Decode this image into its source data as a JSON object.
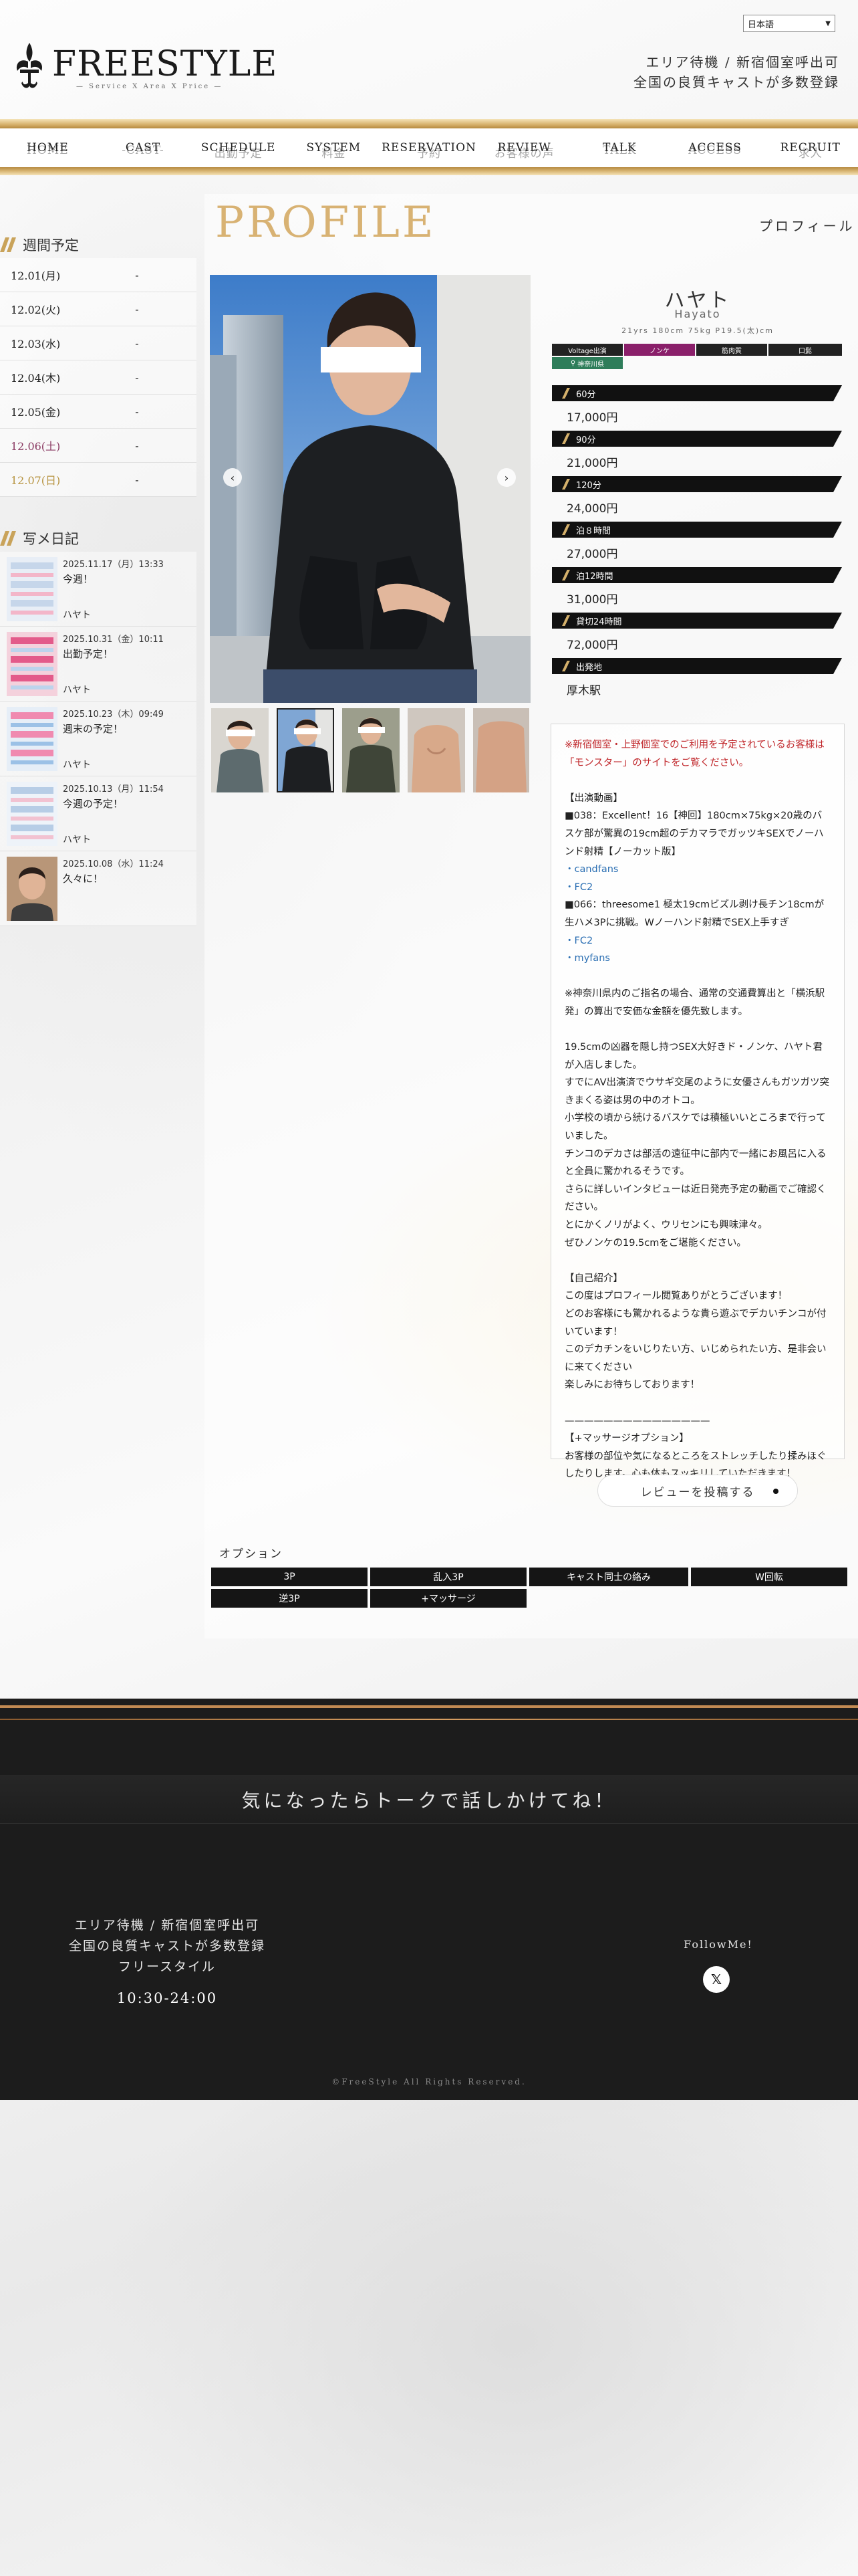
{
  "header": {
    "language": "日本語",
    "logo_text": "FREESTYLE",
    "logo_sub": "— Service X Area X Price —",
    "tagline_1": "エリア待機 / 新宿個室呼出可",
    "tagline_2": "全国の良質キャストが多数登録"
  },
  "nav": {
    "items": [
      {
        "label": "HOME",
        "ghost": "HOME"
      },
      {
        "label": "CAST",
        "ghost": "-CAST-"
      },
      {
        "label": "SCHEDULE",
        "ghost": "出勤予定"
      },
      {
        "label": "SYSTEM",
        "ghost": "料金"
      },
      {
        "label": "RESERVATION",
        "ghost": "予約"
      },
      {
        "label": "REVIEW",
        "ghost": "お客様の声"
      },
      {
        "label": "TALK",
        "ghost": "TALK"
      },
      {
        "label": "ACCESS",
        "ghost": "ACCESS"
      },
      {
        "label": "RECRUIT",
        "ghost": "求人"
      }
    ]
  },
  "sidebar": {
    "schedule_title": "週間予定",
    "schedule": [
      {
        "date": "12.01(月)",
        "value": "-"
      },
      {
        "date": "12.02(火)",
        "value": "-"
      },
      {
        "date": "12.03(水)",
        "value": "-"
      },
      {
        "date": "12.04(木)",
        "value": "-"
      },
      {
        "date": "12.05(金)",
        "value": "-"
      },
      {
        "date": "12.06(土)",
        "value": "-"
      },
      {
        "date": "12.07(日)",
        "value": "-"
      }
    ],
    "diary_title": "写メ日記",
    "diary": [
      {
        "date": "2025.11.17（月）13:33",
        "title": "今週！",
        "author": "ハヤト"
      },
      {
        "date": "2025.10.31（金）10:11",
        "title": "出勤予定！",
        "author": "ハヤト"
      },
      {
        "date": "2025.10.23（木）09:49",
        "title": "週末の予定！",
        "author": "ハヤト"
      },
      {
        "date": "2025.10.13（月）11:54",
        "title": "今週の予定！",
        "author": "ハヤト"
      },
      {
        "date": "2025.10.08（水）11:24",
        "title": "久々に！",
        "author": ""
      }
    ]
  },
  "profile": {
    "heading": "PROFILE",
    "heading_jp": "プロフィール",
    "name_jp": "ハヤト",
    "name_en": "Hayato",
    "specs": "21yrs 180cm 75kg P19.5(太)cm",
    "tags": [
      "Voltage出演",
      "ノンケ",
      "筋肉質",
      "口髭",
      "神奈川県"
    ],
    "prices": [
      {
        "label": "60分",
        "value": "17,000円"
      },
      {
        "label": "90分",
        "value": "21,000円"
      },
      {
        "label": "120分",
        "value": "24,000円"
      },
      {
        "label": "泊８時間",
        "value": "27,000円"
      },
      {
        "label": "泊12時間",
        "value": "31,000円"
      },
      {
        "label": "貸切24時間",
        "value": "72,000円"
      },
      {
        "label": "出発地",
        "value": "厚木駅"
      }
    ],
    "review_button": "レビューを投稿する",
    "options_title": "オプション",
    "options": [
      "3P",
      "乱入3P",
      "キャスト同士の絡み",
      "W回転",
      "逆3P",
      "+マッサージ"
    ]
  },
  "description": {
    "notice": "※新宿個室・上野個室でのご利用を予定されているお客様は「モンスター」のサイトをご覧ください。",
    "lines": [
      "",
      "【出演動画】",
      "■038：Excellent！16【神回】180cm×75kg×20歳のバスケ部が驚異の19cm超のデカマラでガッツキSEXでノーハンド射精【ノーカット版】",
      "・candfans",
      "・FC2",
      "■066：threesome1 極太19cmビズル剥け長チン18cmが生ハメ3Pに挑戦。Wノーハンド射精でSEX上手すぎ",
      "・FC2",
      "・myfans",
      "",
      "※神奈川県内のご指名の場合、通常の交通費算出と「横浜駅発」の算出で安価な金額を優先致します。",
      "",
      "19.5cmの凶器を隠し持つSEX大好きド・ノンケ、ハヤト君が入店しました。",
      "すでにAV出演済でウサギ交尾のように女優さんもガツガツ突きまくる姿は男の中のオトコ。",
      "小学校の頃から続けるバスケでは積極いいところまで行っていました。",
      "チンコのデカさは部活の遠征中に部内で一緒にお風呂に入ると全員に驚かれるそうです。",
      "さらに詳しいインタビューは近日発売予定の動画でご確認ください。",
      "とにかくノリがよく、ウリセンにも興味津々。",
      "ぜひノンケの19.5cmをご堪能ください。",
      "",
      "【自己紹介】",
      "この度はプロフィール閲覧ありがとうございます！",
      "どのお客様にも驚かれるような貴ら遊ぶでデカいチンコが付いています！",
      "このデカチンをいじりたい方、いじめられたい方、是非会いに来てください",
      "楽しみにお待ちしております！",
      "",
      "———————————————",
      "【+マッサージオプション】",
      "お客様の部位や気になるところをストレッチしたり揉みほぐしたりします。心も体もスッキリしていただきます！"
    ]
  },
  "footer": {
    "talk_banner": "気になったらトークで話しかけてね！",
    "line1": "エリア待機 / 新宿個室呼出可",
    "line2": "全国の良質キャストが多数登録",
    "line3": "フリースタイル",
    "hours": "10:30-24:00",
    "follow": "FollowMe!",
    "x_icon": "x-icon",
    "copyright": "©FreeStyle All Rights Reserved."
  },
  "colors": {
    "gold": "#d8b273",
    "tag_green": "#2e7d5a",
    "tag_magenta": "#8a1f6a",
    "notice_red": "#c0262a",
    "link_blue": "#2b6fb3"
  }
}
